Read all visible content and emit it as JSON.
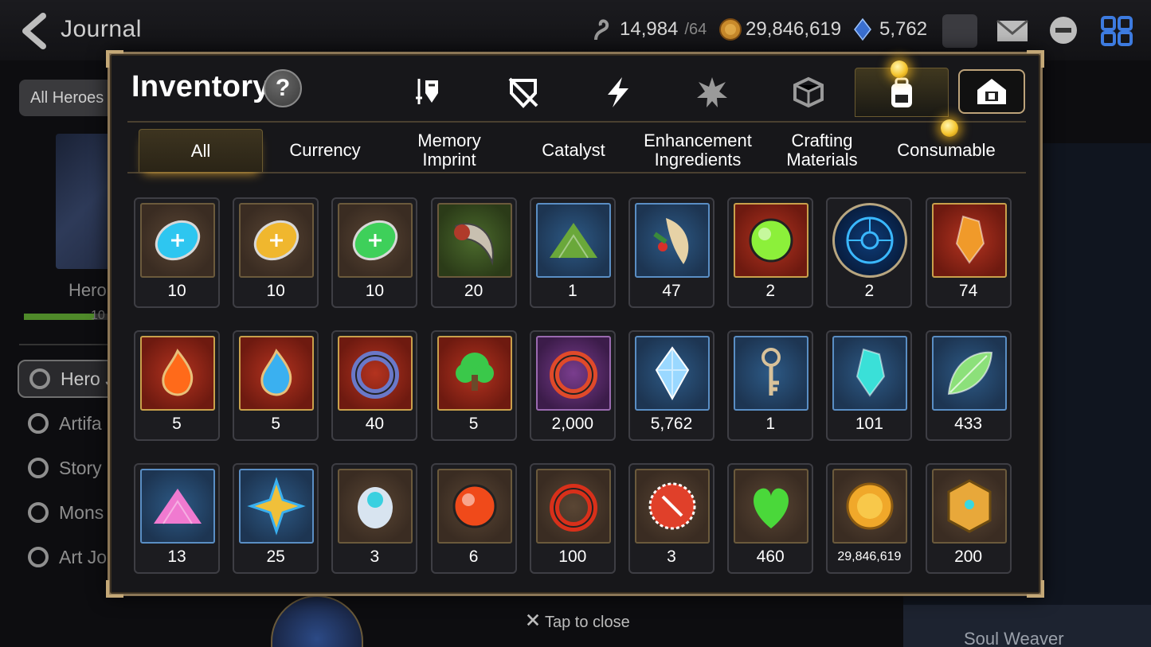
{
  "journal": {
    "title": "Journal",
    "filter_label": "All Heroes",
    "heroes_label": "Hero",
    "progress_text": "10",
    "progress_fraction": 0.8,
    "sidebar": [
      {
        "label": "Hero J",
        "icon": "hero-journal-icon",
        "active": true
      },
      {
        "label": "Artifa",
        "icon": "artifact-icon",
        "active": false
      },
      {
        "label": "Story",
        "icon": "story-icon",
        "active": false
      },
      {
        "label": "Mons",
        "icon": "monster-icon",
        "active": false
      },
      {
        "label": "Art Jo",
        "icon": "art-journal-icon",
        "active": false
      }
    ],
    "soul_weaver": "Soul Weaver"
  },
  "currencies": {
    "stamina": {
      "value": "14,984",
      "max": "/64",
      "icon": "stamina-icon"
    },
    "gold": {
      "value": "29,846,619",
      "icon": "gold-icon"
    },
    "skystone": {
      "value": "5,762",
      "icon": "skystone-icon"
    }
  },
  "inventory": {
    "title": "Inventory",
    "help": "?",
    "category_icons": [
      "hero-equipment-icon",
      "artifact-broken-icon",
      "lightning-icon",
      "splash-icon",
      "material-cube-icon",
      "backpack-icon",
      "storage-house-icon"
    ],
    "tabs": [
      {
        "label": "All",
        "active": true
      },
      {
        "label": "Currency",
        "active": false
      },
      {
        "label": "Memory\nImprint",
        "active": false
      },
      {
        "label": "Catalyst",
        "active": false
      },
      {
        "label": "Enhancement\nIngredients",
        "active": false
      },
      {
        "label": "Crafting\nMaterials",
        "active": false
      },
      {
        "label": "Consumable",
        "active": false
      }
    ],
    "items": [
      {
        "qty": "10",
        "frame": "brown",
        "icon": "blue-rune-icon"
      },
      {
        "qty": "10",
        "frame": "brown",
        "icon": "yellow-rune-icon"
      },
      {
        "qty": "10",
        "frame": "brown",
        "icon": "green-rune-icon"
      },
      {
        "qty": "20",
        "frame": "green",
        "icon": "claw-icon"
      },
      {
        "qty": "1",
        "frame": "blue",
        "icon": "green-pile-icon"
      },
      {
        "qty": "47",
        "frame": "blue",
        "icon": "feather-icon"
      },
      {
        "qty": "2",
        "frame": "red",
        "icon": "green-orb-icon"
      },
      {
        "qty": "2",
        "frame": "round",
        "icon": "blue-circuit-icon"
      },
      {
        "qty": "74",
        "frame": "red",
        "icon": "flame-crystal-icon"
      },
      {
        "qty": "5",
        "frame": "red",
        "icon": "fire-charm-icon"
      },
      {
        "qty": "5",
        "frame": "red",
        "icon": "water-charm-icon"
      },
      {
        "qty": "40",
        "frame": "red",
        "icon": "ring-charm-icon"
      },
      {
        "qty": "5",
        "frame": "red",
        "icon": "tree-charm-icon"
      },
      {
        "qty": "2,000",
        "frame": "purple",
        "icon": "flower-ring-icon"
      },
      {
        "qty": "5,762",
        "frame": "blue",
        "icon": "skystone-gem-icon"
      },
      {
        "qty": "1",
        "frame": "blue",
        "icon": "clock-key-icon"
      },
      {
        "qty": "101",
        "frame": "blue",
        "icon": "cyan-crystal-icon"
      },
      {
        "qty": "433",
        "frame": "blue",
        "icon": "leaf-icon"
      },
      {
        "qty": "13",
        "frame": "blue",
        "icon": "pink-crystal-pile-icon"
      },
      {
        "qty": "25",
        "frame": "blue",
        "icon": "star-charm-icon"
      },
      {
        "qty": "3",
        "frame": "brown",
        "icon": "pet-capsule-icon"
      },
      {
        "qty": "6",
        "frame": "brown",
        "icon": "red-lightning-orb-icon"
      },
      {
        "qty": "100",
        "frame": "brown",
        "icon": "red-bracelet-icon"
      },
      {
        "qty": "3",
        "frame": "brown",
        "icon": "red-badge-icon"
      },
      {
        "qty": "460",
        "frame": "brown",
        "icon": "green-heart-icon"
      },
      {
        "qty": "29,846,619",
        "frame": "brown",
        "icon": "gold-coin-icon"
      },
      {
        "qty": "200",
        "frame": "brown",
        "icon": "gold-emblem-icon"
      }
    ]
  },
  "tap_to_close": "Tap to close",
  "colors": {
    "accent_gold": "#f5c530",
    "frame_border": "#8b7656"
  }
}
